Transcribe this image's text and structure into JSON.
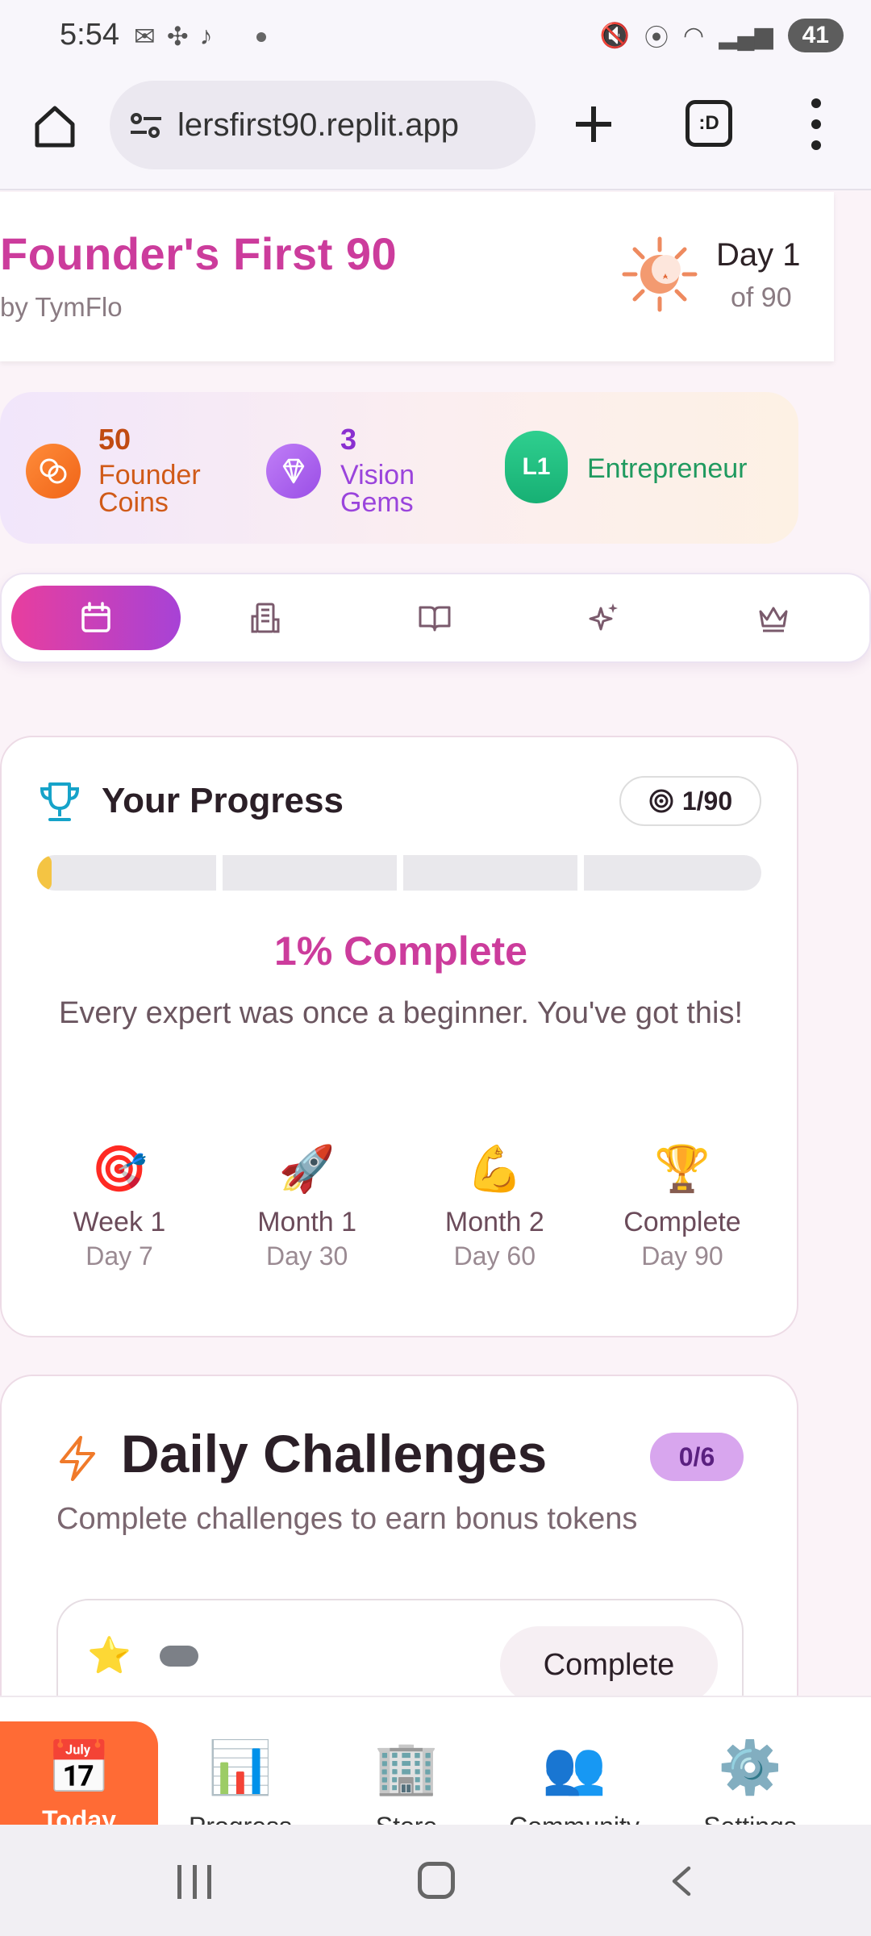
{
  "status_bar": {
    "time": "5:54",
    "battery": "41"
  },
  "browser": {
    "url": "lersfirst90.replit.app",
    "tabs_label": ":D"
  },
  "header": {
    "title": "Founder's First 90",
    "subtitle": "by TymFlo",
    "day_label": "Day 1",
    "day_of": "of 90"
  },
  "stats": {
    "coins_value": "50",
    "coins_label": "Founder Coins",
    "gems_value": "3",
    "gems_label": "Vision Gems",
    "level_badge": "L1",
    "level_label": "Entrepreneur"
  },
  "tabs": [
    {
      "icon": "calendar-icon",
      "active": true
    },
    {
      "icon": "building-icon",
      "active": false
    },
    {
      "icon": "book-open-icon",
      "active": false
    },
    {
      "icon": "sparkles-icon",
      "active": false
    },
    {
      "icon": "crown-icon",
      "active": false
    }
  ],
  "progress": {
    "title": "Your Progress",
    "pill": "1/90",
    "fraction": 0.011,
    "percent_text": "1% Complete",
    "motivation": "Every expert was once a beginner. You've got this!",
    "milestones": [
      {
        "emoji": "🎯",
        "name": "Week 1",
        "day": "Day 7"
      },
      {
        "emoji": "🚀",
        "name": "Month 1",
        "day": "Day 30"
      },
      {
        "emoji": "💪",
        "name": "Month 2",
        "day": "Day 60"
      },
      {
        "emoji": "🏆",
        "name": "Complete",
        "day": "Day 90"
      }
    ]
  },
  "daily": {
    "title": "Daily Challenges",
    "badge": "0/6",
    "subtitle": "Complete challenges to earn bonus tokens",
    "first_item": {
      "emoji": "⭐",
      "button": "Complete"
    }
  },
  "bottom_nav": [
    {
      "emoji": "📅",
      "label": "Today",
      "active": true
    },
    {
      "emoji": "📊",
      "label": "Progress",
      "active": false
    },
    {
      "emoji": "🏢",
      "label": "Store",
      "active": false
    },
    {
      "emoji": "👥",
      "label": "Community",
      "active": false
    },
    {
      "emoji": "⚙️",
      "label": "Settings",
      "active": false
    }
  ],
  "colors": {
    "brand_pink": "#cc3c9c",
    "coin_orange": "#f06418",
    "gem_purple": "#9a4ee6",
    "level_green": "#17b074",
    "nav_active": "#ff6b35",
    "progress_fill": "#f4c443"
  }
}
